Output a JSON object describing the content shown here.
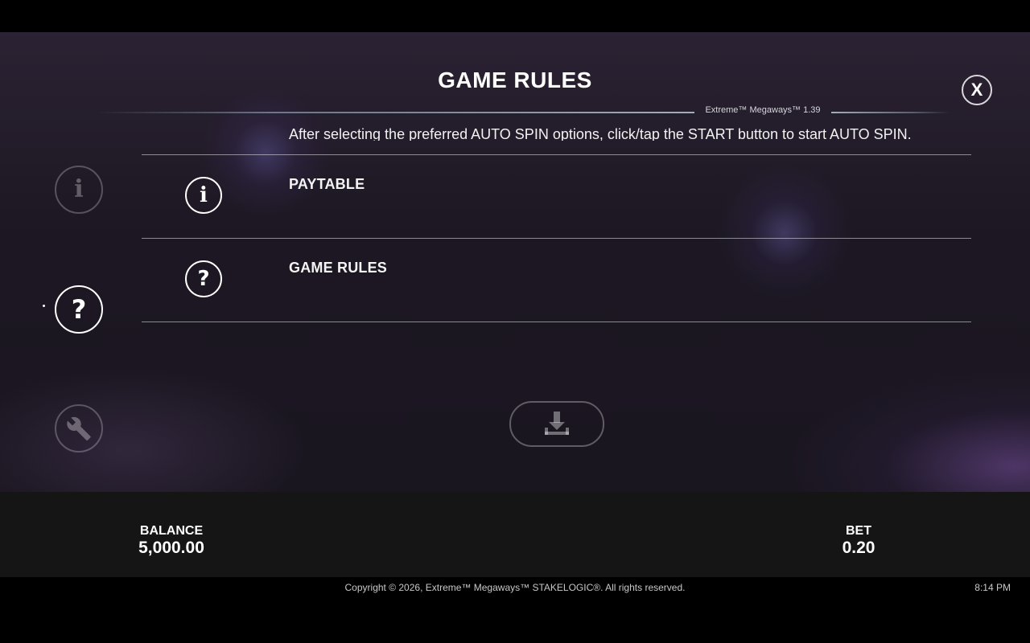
{
  "header": {
    "title": "GAME RULES",
    "version": "Extreme™ Megaways™ 1.39",
    "close_label": "X"
  },
  "sidebar": {
    "items": [
      {
        "name": "paytable",
        "glyph": "i",
        "active": false
      },
      {
        "name": "game-rules",
        "glyph": "?",
        "active": true
      },
      {
        "name": "settings",
        "glyph": "wrench-icon",
        "active": false
      }
    ]
  },
  "content": {
    "auto_spin_text": "After selecting the preferred AUTO SPIN options, click/tap the START button to start AUTO SPIN.",
    "menu": [
      {
        "label": "PAYTABLE",
        "icon": "i"
      },
      {
        "label": "GAME RULES",
        "icon": "?"
      }
    ],
    "download_icon": "download-icon"
  },
  "footer": {
    "balance_label": "BALANCE",
    "balance_value": "5,000.00",
    "bet_label": "BET",
    "bet_value": "0.20",
    "copyright": "Copyright © 2026, Extreme™ Megaways™ STAKELOGIC®. All rights reserved.",
    "clock": "8:14 PM"
  },
  "colors": {
    "background": "#1c1722",
    "footer": "#151515",
    "accent_line": "#bed2e1"
  }
}
